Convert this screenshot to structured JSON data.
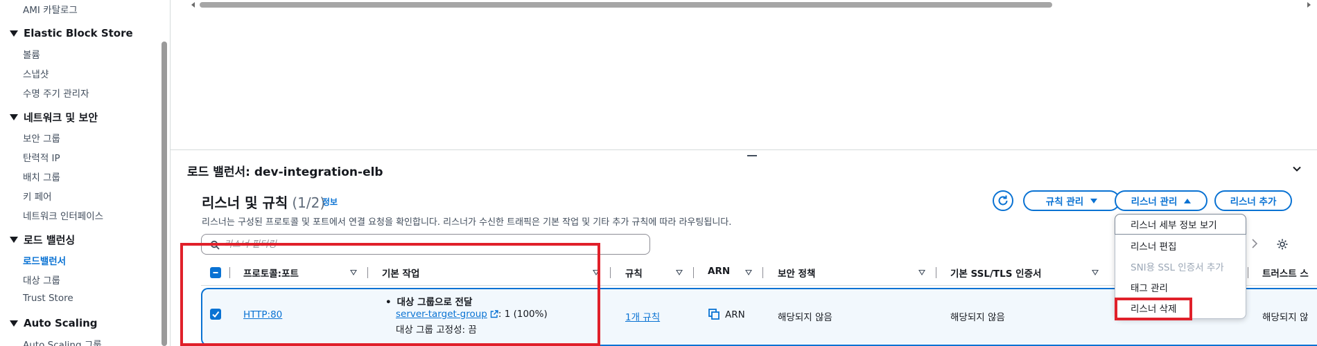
{
  "sidebar": {
    "ami_catalog": "AMI 카탈로그",
    "groups": [
      {
        "title": "Elastic Block Store",
        "items": [
          "볼륨",
          "스냅샷",
          "수명 주기 관리자"
        ]
      },
      {
        "title": "네트워크 및 보안",
        "items": [
          "보안 그룹",
          "탄력적 IP",
          "배치 그룹",
          "키 페어",
          "네트워크 인터페이스"
        ]
      },
      {
        "title": "로드 밸런싱",
        "items": [
          "로드밸런서",
          "대상 그룹",
          "Trust Store"
        ]
      },
      {
        "title": "Auto Scaling",
        "items": [
          "Auto Scaling 그룹"
        ]
      }
    ],
    "active_item": "로드밸런서"
  },
  "panel": {
    "title": "로드 밸런서: dev-integration-elb"
  },
  "listeners": {
    "title": "리스너 및 규칙",
    "count": "(1/2)",
    "info": "정보",
    "description": "리스너는 구성된 프로토콜 및 포트에서 연결 요청을 확인합니다. 리스너가 수신한 트래픽은 기본 작업 및 기타 추가 규칙에 따라 라우팅됩니다.",
    "filter_placeholder": "리스너 필터링",
    "buttons": {
      "manage_rules": "규칙 관리",
      "manage_listener": "리스너 관리",
      "add_listener": "리스너 추가"
    },
    "dropdown": [
      {
        "label": "리스너 세부 정보 보기",
        "disabled": false
      },
      {
        "label": "리스너 편집",
        "disabled": false
      },
      {
        "label": "SNI용 SSL 인증서 추가",
        "disabled": true
      },
      {
        "label": "태그 관리",
        "disabled": false
      },
      {
        "label": "리스너 삭제",
        "disabled": false
      }
    ],
    "columns": [
      "프로토콜:포트",
      "기본 작업",
      "규칙",
      "ARN",
      "보안 정책",
      "기본 SSL/TLS 인증서",
      "트러스트 스"
    ],
    "row": {
      "protocol_port": "HTTP:80",
      "action_title": "대상 그룹으로 전달",
      "target_group": "server-target-group",
      "weight": ": 1 (100%)",
      "stickiness": "대상 그룹 고정성: 끔",
      "rules": "1개 규칙",
      "arn": "ARN",
      "security_policy": "해당되지 않음",
      "ssl_cert": "해당되지 않음",
      "trust_store": "해당되지 않"
    }
  },
  "colors": {
    "link": "#0972d3",
    "annotation": "#e0202a",
    "selected_row_bg": "#f2f8fd"
  }
}
